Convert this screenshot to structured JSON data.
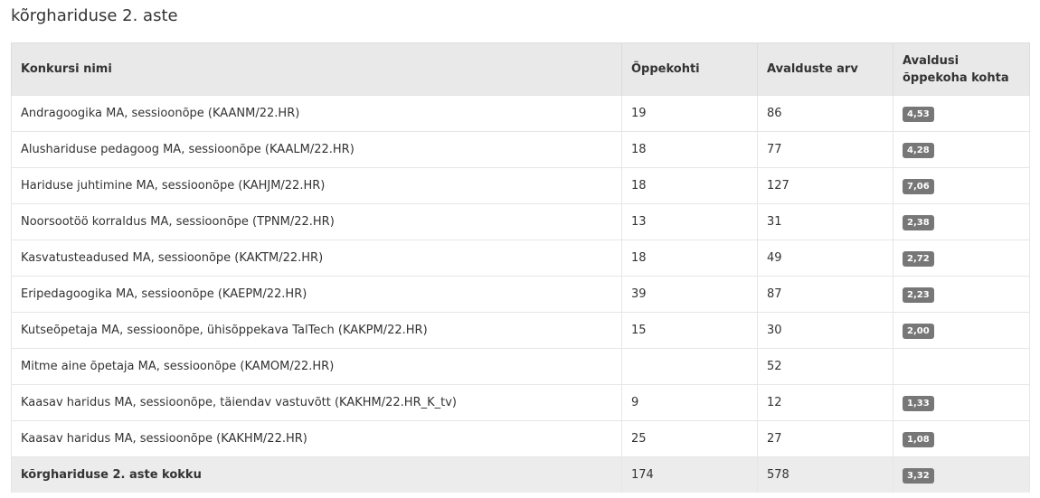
{
  "page": {
    "title": "kõrghariduse 2. aste"
  },
  "table": {
    "headers": [
      "Konkursi nimi",
      "Õppekohti",
      "Avalduste arv",
      "Avaldusi õppekoha kohta"
    ],
    "rows": [
      {
        "name": "Andragoogika MA, sessioonõpe (KAANM/22.HR)",
        "places": "19",
        "applications": "86",
        "ratio": "4,53"
      },
      {
        "name": "Alushariduse pedagoog MA, sessioonõpe (KAALM/22.HR)",
        "places": "18",
        "applications": "77",
        "ratio": "4,28"
      },
      {
        "name": "Hariduse juhtimine MA, sessioonõpe (KAHJM/22.HR)",
        "places": "18",
        "applications": "127",
        "ratio": "7,06"
      },
      {
        "name": "Noorsootöö korraldus MA, sessioonõpe (TPNM/22.HR)",
        "places": "13",
        "applications": "31",
        "ratio": "2,38"
      },
      {
        "name": "Kasvatusteadused MA, sessioonõpe (KAKTM/22.HR)",
        "places": "18",
        "applications": "49",
        "ratio": "2,72"
      },
      {
        "name": "Eripedagoogika MA, sessioonõpe (KAEPM/22.HR)",
        "places": "39",
        "applications": "87",
        "ratio": "2,23"
      },
      {
        "name": "Kutseõpetaja MA, sessioonõpe, ühisõppekava TalTech (KAKPM/22.HR)",
        "places": "15",
        "applications": "30",
        "ratio": "2,00"
      },
      {
        "name": "Mitme aine õpetaja MA, sessioonõpe (KAMOM/22.HR)",
        "places": "",
        "applications": "52",
        "ratio": ""
      },
      {
        "name": "Kaasav haridus MA, sessioonõpe, täiendav vastuvõtt (KAKHM/22.HR_K_tv)",
        "places": "9",
        "applications": "12",
        "ratio": "1,33"
      },
      {
        "name": "Kaasav haridus MA, sessioonõpe (KAKHM/22.HR)",
        "places": "25",
        "applications": "27",
        "ratio": "1,08"
      }
    ],
    "total": {
      "name": "kõrghariduse 2. aste kokku",
      "places": "174",
      "applications": "578",
      "ratio": "3,32"
    }
  }
}
